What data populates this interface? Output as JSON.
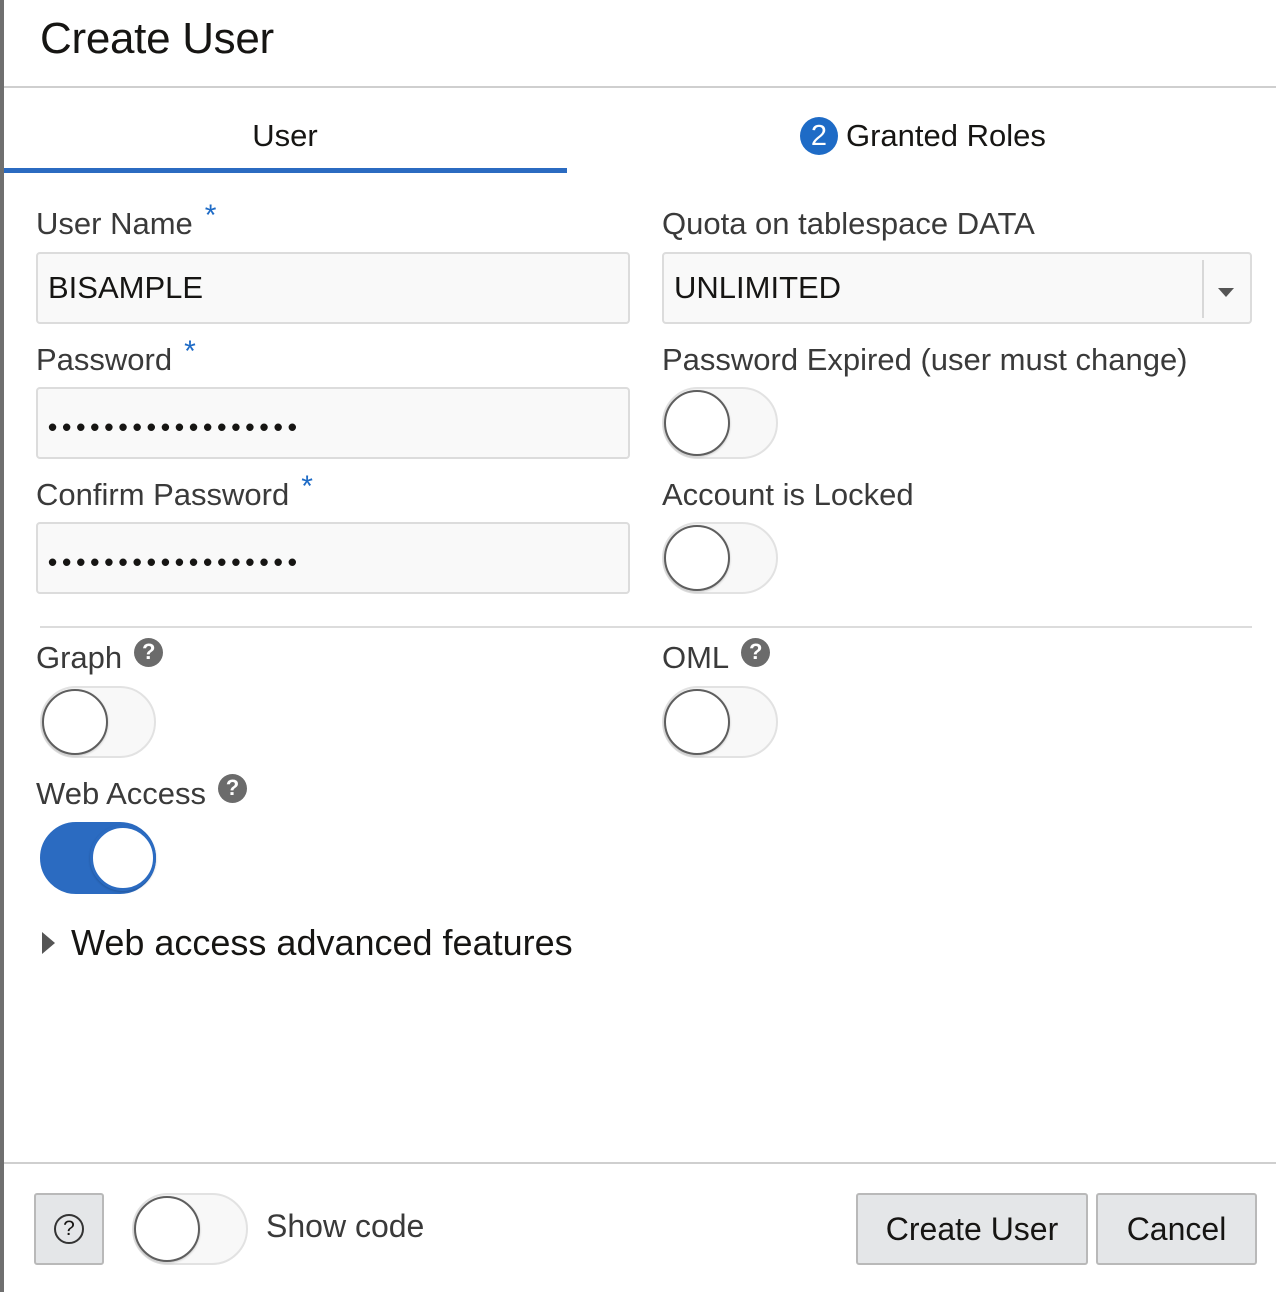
{
  "dialog": {
    "title": "Create User"
  },
  "tabs": {
    "user": {
      "label": "User"
    },
    "roles": {
      "label": "Granted Roles",
      "badge": "2"
    }
  },
  "form": {
    "user_name": {
      "label": "User Name",
      "required": "*",
      "value": "BISAMPLE"
    },
    "password": {
      "label": "Password",
      "required": "*",
      "value": "••••••••••••••••••"
    },
    "confirm_password": {
      "label": "Confirm Password",
      "required": "*",
      "value": "••••••••••••••••••"
    },
    "quota": {
      "label": "Quota on tablespace DATA",
      "selected": "UNLIMITED"
    },
    "password_expired": {
      "label": "Password Expired (user must change)",
      "on": false
    },
    "account_locked": {
      "label": "Account is Locked",
      "on": false
    },
    "graph": {
      "label": "Graph",
      "on": false,
      "help": "?"
    },
    "oml": {
      "label": "OML",
      "on": false,
      "help": "?"
    },
    "web_access": {
      "label": "Web Access",
      "on": true,
      "help": "?"
    },
    "advanced": {
      "label": "Web access advanced features"
    }
  },
  "footer": {
    "help_glyph": "?",
    "show_code": {
      "label": "Show code",
      "on": false
    },
    "create_label": "Create User",
    "cancel_label": "Cancel"
  },
  "colors": {
    "accent": "#2b6bc1",
    "badge": "#1e6bc6",
    "required": "#1e6bc6"
  }
}
